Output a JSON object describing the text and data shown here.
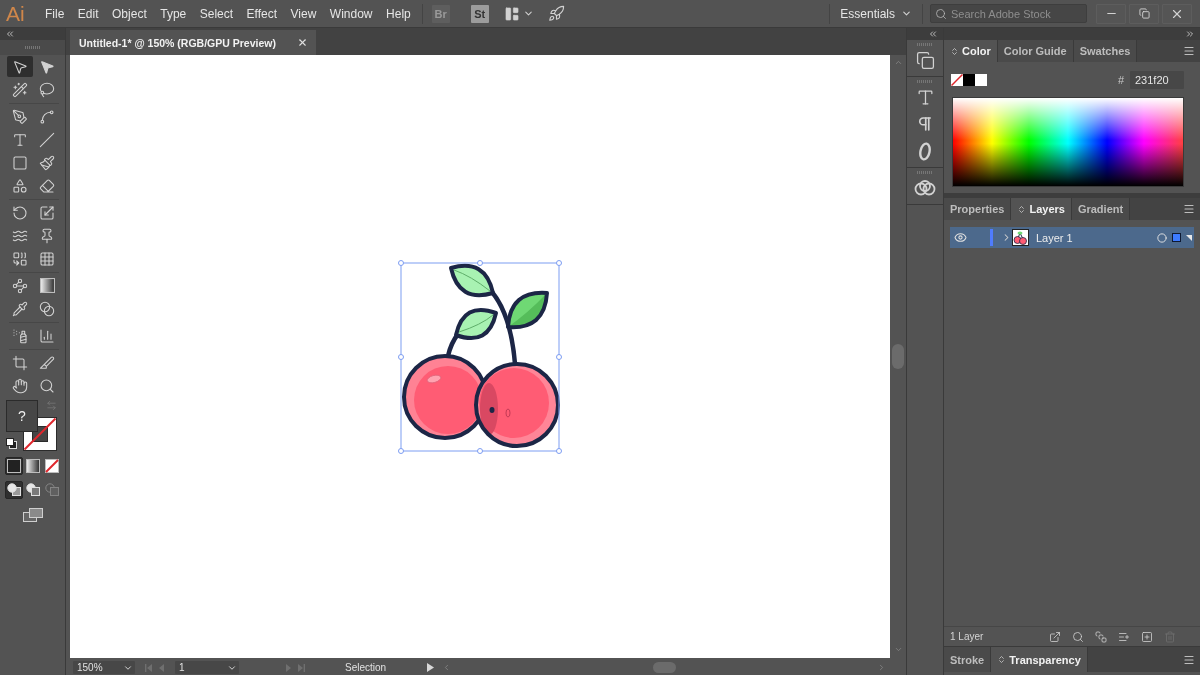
{
  "menu_bar": {
    "logo": "Ai",
    "menus": [
      "File",
      "Edit",
      "Object",
      "Type",
      "Select",
      "Effect",
      "View",
      "Window",
      "Help"
    ],
    "app_buttons": [
      {
        "label": "Br",
        "disabled": true
      },
      {
        "label": "St",
        "disabled": false
      }
    ],
    "workspace": "Essentials",
    "search": {
      "placeholder": "Search Adobe Stock"
    }
  },
  "document_tabs": [
    {
      "title": "Untitled-1* @ 150% (RGB/GPU Preview)",
      "selected": true
    }
  ],
  "toolbar": {
    "groups": [
      {
        "tools": [
          {
            "kind": "select",
            "selected": true
          },
          {
            "kind": "direct",
            "selected": false
          },
          {
            "kind": "wand",
            "selected": false
          },
          {
            "kind": "lasso",
            "selected": false
          }
        ]
      },
      {
        "tools": [
          {
            "kind": "pen",
            "selected": false
          },
          {
            "kind": "curvature",
            "selected": false
          },
          {
            "kind": "type",
            "selected": false
          },
          {
            "kind": "line",
            "selected": false
          },
          {
            "kind": "rect",
            "selected": false
          },
          {
            "kind": "brush",
            "selected": false
          },
          {
            "kind": "shaper",
            "selected": false
          },
          {
            "kind": "eraser",
            "selected": false
          }
        ]
      },
      {
        "tools": [
          {
            "kind": "rotate",
            "selected": false
          },
          {
            "kind": "scale",
            "selected": false
          },
          {
            "kind": "warp",
            "selected": false
          },
          {
            "kind": "pin",
            "selected": false
          },
          {
            "kind": "shapebuilder",
            "selected": false
          },
          {
            "kind": "perspective",
            "selected": false
          }
        ]
      },
      {
        "tools": [
          {
            "kind": "mesh",
            "selected": false
          },
          {
            "kind": "gradient",
            "selected": false
          },
          {
            "kind": "eyedropper",
            "selected": false
          },
          {
            "kind": "blend",
            "selected": false
          }
        ]
      },
      {
        "tools": [
          {
            "kind": "symbol",
            "selected": false
          },
          {
            "kind": "graph",
            "selected": false
          }
        ]
      },
      {
        "tools": [
          {
            "kind": "artboard",
            "selected": false
          },
          {
            "kind": "slice",
            "selected": false
          },
          {
            "kind": "hand",
            "selected": false
          },
          {
            "kind": "zoom",
            "selected": false
          }
        ]
      }
    ],
    "fill_label": "?",
    "stroke_none": true,
    "color_modes": [
      {
        "kind": "color",
        "selected": true
      },
      {
        "kind": "gradient",
        "selected": false
      },
      {
        "kind": "none",
        "selected": false
      }
    ],
    "draw_modes": [
      {
        "kind": "normal",
        "selected": true,
        "disabled": false
      },
      {
        "kind": "behind",
        "selected": false,
        "disabled": false
      },
      {
        "kind": "inside",
        "selected": false,
        "disabled": true
      }
    ]
  },
  "canvas": {
    "artwork_selected": true
  },
  "status_bar": {
    "zoom": "150%",
    "artboard": "1",
    "status": "Selection"
  },
  "dock": {
    "groups": [
      {
        "items": [
          {
            "kind": "arrange"
          }
        ]
      },
      {
        "items": [
          {
            "kind": "character"
          },
          {
            "kind": "paragraph"
          },
          {
            "kind": "opentype"
          }
        ]
      },
      {
        "items": [
          {
            "kind": "libraries"
          }
        ]
      }
    ]
  },
  "color_panel": {
    "tabs": [
      {
        "label": "Color",
        "selected": true
      },
      {
        "label": "Color Guide",
        "selected": false
      },
      {
        "label": "Swatches",
        "selected": false
      }
    ],
    "hex_label": "#",
    "hex": "231f20"
  },
  "layers_panel": {
    "tabs": [
      {
        "label": "Properties",
        "selected": false
      },
      {
        "label": "Layers",
        "selected": true
      },
      {
        "label": "Gradient",
        "selected": false
      }
    ],
    "layers": [
      {
        "name": "Layer 1",
        "visible": true,
        "expanded": false,
        "selected": true,
        "art_selected": true,
        "color": "#4f7cff"
      }
    ],
    "count": "1 Layer"
  },
  "bottom_panel": {
    "tabs": [
      {
        "label": "Stroke",
        "selected": false
      },
      {
        "label": "Transparency",
        "selected": true
      }
    ]
  }
}
